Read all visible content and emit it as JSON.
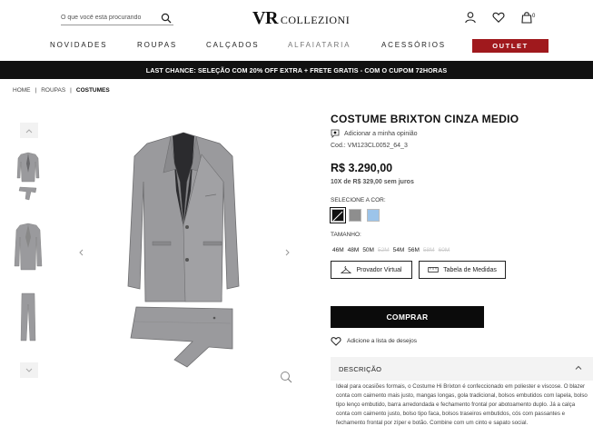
{
  "header": {
    "search_placeholder": "O que você está procurando",
    "logo_vr": "VR",
    "logo_name": "COLLEZIONI",
    "cart_count": "0"
  },
  "nav": {
    "items": [
      "NOVIDADES",
      "ROUPAS",
      "CALÇADOS",
      "ALFAIATARIA",
      "ACESSÓRIOS"
    ],
    "outlet": "OUTLET"
  },
  "promo": "LAST CHANCE: SELEÇÃO COM 20% OFF EXTRA + FRETE GRATIS - COM O CUPOM 72HORAS",
  "breadcrumb": [
    "HOME",
    "|",
    "ROUPAS",
    "|",
    "COSTUMES"
  ],
  "product": {
    "title": "COSTUME BRIXTON CINZA MEDIO",
    "review_label": "Adicionar a minha opinião",
    "code": "Cod.: VM123CL0052_64_3",
    "price": "R$ 3.290,00",
    "installments": "10X de R$ 329,00 sem juros",
    "color_label": "SELECIONE A COR:",
    "colors": [
      "#111111",
      "#8e8e8e",
      "#9cc4ea"
    ],
    "size_label": "TAMANHO:",
    "sizes": [
      {
        "label": "46M",
        "available": true
      },
      {
        "label": "48M",
        "available": true
      },
      {
        "label": "50M",
        "available": true
      },
      {
        "label": "52M",
        "available": false
      },
      {
        "label": "54M",
        "available": true
      },
      {
        "label": "56M",
        "available": true
      },
      {
        "label": "58M",
        "available": false
      },
      {
        "label": "60M",
        "available": false
      }
    ],
    "virtual_fitter": "Provador Virtual",
    "size_chart": "Tabela de Medidas",
    "buy": "COMPRAR",
    "wishlist": "Adicione a lista de desejos",
    "description_label": "DESCRIÇÃO",
    "description": "Ideal para ocasiões formais, o Costume Hi Brixton é confeccionado em poliester e viscose. O blazer conta com caimento mais justo, mangas longas, gola tradicional, bolsos embutidos com lapela, bolso tipo lenço embutido, barra arredondada e fechamento frontal por abotoamento duplo. Já a calça conta com caimento justo, bolso tipo faca, bolsos traseiros embutidos, cós com passantes e fechamento frontal por zíper e botão. Combine com um cinto e sapato social."
  },
  "colors": {
    "outlet_bg": "#a0191d",
    "promo_bg": "#111111",
    "suit_gray": "#9a9a9d"
  }
}
